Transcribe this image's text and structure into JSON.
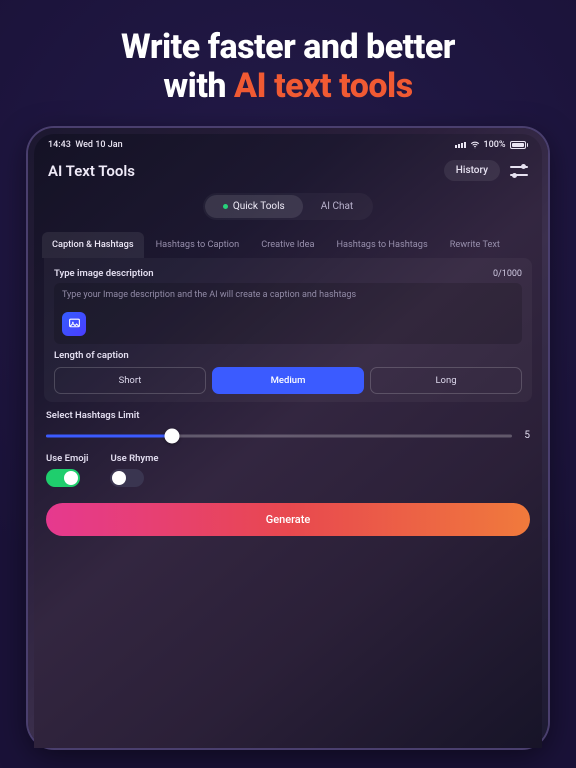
{
  "promo": {
    "line1": "Write faster and better",
    "line2_prefix": "with ",
    "line2_accent": "AI text tools"
  },
  "status": {
    "time": "14:43",
    "date": "Wed 10 Jan",
    "battery_pct": "100%"
  },
  "header": {
    "title": "AI Text Tools",
    "history_label": "History"
  },
  "mode_tabs": {
    "quick": "Quick Tools",
    "chat": "AI Chat"
  },
  "subtabs": {
    "caption_hashtags": "Caption & Hashtags",
    "hashtags_to_caption": "Hashtags to Caption",
    "creative_idea": "Creative Idea",
    "hashtags_to_hashtags": "Hashtags to Hashtags",
    "rewrite_text": "Rewrite Text"
  },
  "input": {
    "label": "Type image description",
    "counter": "0/1000",
    "placeholder": "Type your Image description and the AI will create a caption and hashtags"
  },
  "length": {
    "label": "Length of caption",
    "short": "Short",
    "medium": "Medium",
    "long": "Long"
  },
  "hashtags_limit": {
    "label": "Select Hashtags Limit",
    "value": "5"
  },
  "toggles": {
    "emoji_label": "Use Emoji",
    "rhyme_label": "Use Rhyme"
  },
  "generate_label": "Generate"
}
